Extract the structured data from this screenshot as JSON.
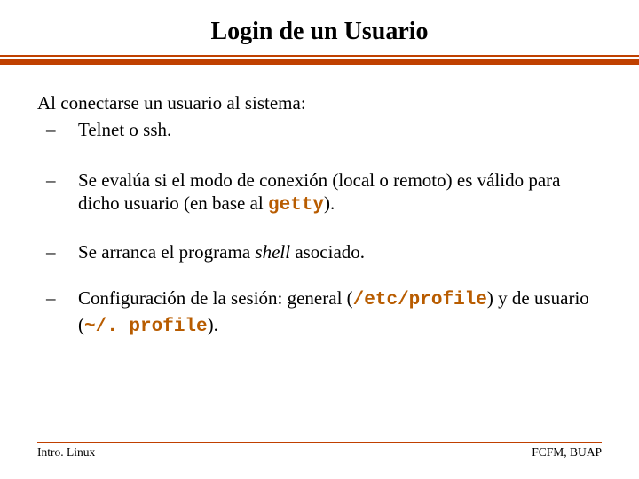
{
  "title": "Login de un Usuario",
  "lead": "Al conectarse un usuario al sistema:",
  "bullets": {
    "b1": "Telnet o ssh.",
    "b2a": "Se evalúa si el modo de conexión (local o remoto) es válido para dicho usuario (en base al ",
    "b2code": "getty",
    "b2b": ").",
    "b3a": "Se arranca el programa ",
    "b3i": "shell",
    "b3b": " asociado.",
    "b4a": "Configuración de la sesión: general (",
    "b4code1": "/etc/profile",
    "b4b": ") y de usuario (",
    "b4code2": "~/. profile",
    "b4c": ")."
  },
  "dash": "–",
  "footer": {
    "left": "Intro. Linux",
    "right": "FCFM, BUAP"
  }
}
